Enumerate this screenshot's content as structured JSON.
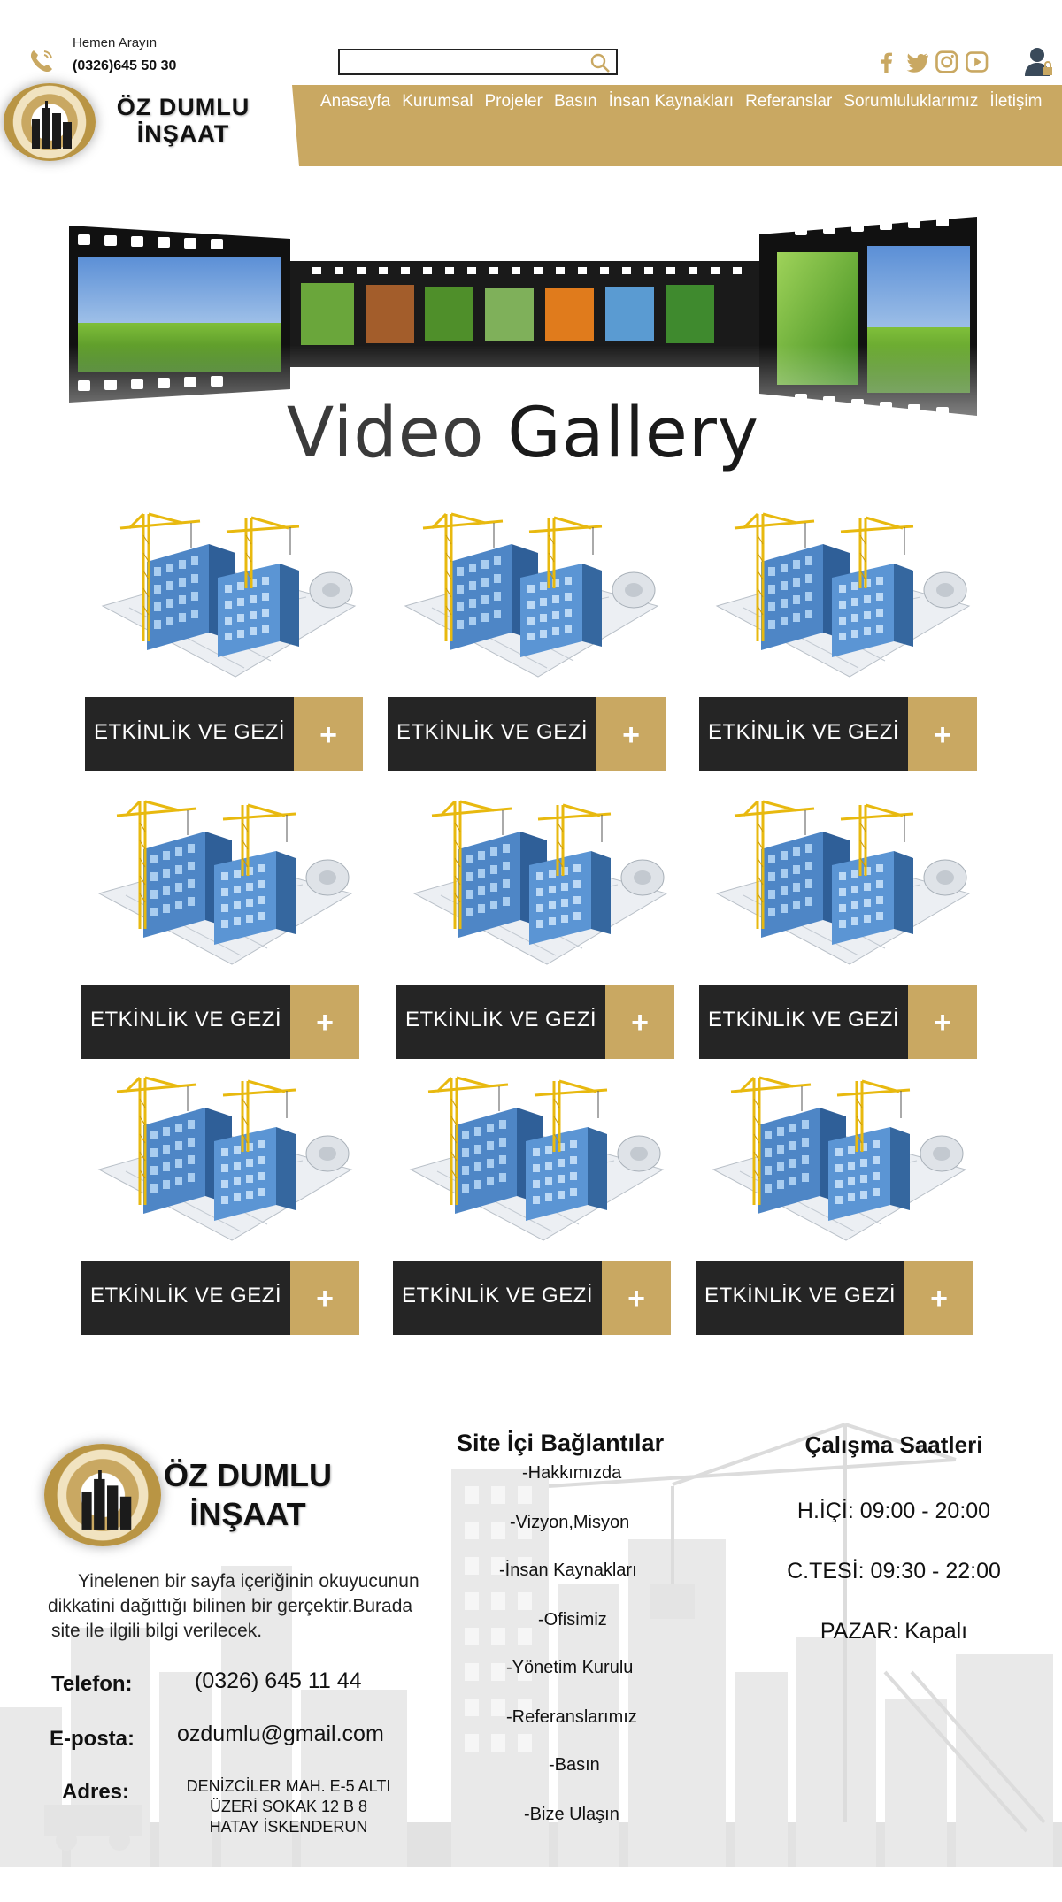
{
  "header": {
    "call_label": "Hemen Arayın",
    "call_number": "(0326)645 50 30",
    "logo_line1": "ÖZ DUMLU",
    "logo_line2": "İNŞAAT",
    "search_placeholder": "",
    "social_icons": [
      "facebook-icon",
      "twitter-icon",
      "instagram-icon",
      "youtube-icon"
    ],
    "nav": [
      "Anasayfa",
      "Kurumsal",
      "Projeler",
      "Basın",
      "İnsan Kaynakları",
      "Referanslar",
      "Sorumluluklarımız",
      "İletişim"
    ]
  },
  "hero": {
    "title_part1": "Video",
    "title_part2": "Gallery"
  },
  "gallery": {
    "items": [
      {
        "label": "ETKİNLİK VE GEZİ",
        "plus": "+"
      },
      {
        "label": "ETKİNLİK VE GEZİ",
        "plus": "+"
      },
      {
        "label": "ETKİNLİK VE GEZİ",
        "plus": "+"
      },
      {
        "label": "ETKİNLİK VE GEZİ",
        "plus": "+"
      },
      {
        "label": "ETKİNLİK VE GEZİ",
        "plus": "+"
      },
      {
        "label": "ETKİNLİK VE GEZİ",
        "plus": "+"
      },
      {
        "label": "ETKİNLİK VE GEZİ",
        "plus": "+"
      },
      {
        "label": "ETKİNLİK VE GEZİ",
        "plus": "+"
      },
      {
        "label": "ETKİNLİK VE GEZİ",
        "plus": "+"
      }
    ]
  },
  "footer": {
    "logo_line1": "ÖZ DUMLU",
    "logo_line2": "İNŞAAT",
    "desc_line1": "Yinelenen bir sayfa içeriğinin okuyucunun",
    "desc_line2": "dikkatini dağıttığı bilinen bir gerçektir.Burada",
    "desc_line3": "site ile ilgili  bilgi verilecek.",
    "phone_label": "Telefon:",
    "phone_value": "(0326) 645 11 44",
    "email_label": "E-posta:",
    "email_value": "ozdumlu@gmail.com",
    "address_label": "Adres:",
    "address_line1": "DENİZCİLER MAH. E-5 ALTI",
    "address_line2": "ÜZERİ SOKAK 12 B 8",
    "address_line3": "HATAY İSKENDERUN",
    "links_title": "Site İçi Bağlantılar",
    "links": [
      "-Hakkımızda",
      "-Vizyon,Misyon",
      "-İnsan Kaynakları",
      "-Ofisimiz",
      "-Yönetim Kurulu",
      "-Referanslarımız",
      "-Basın",
      "-Bize Ulaşın"
    ],
    "hours_title": "Çalışma Saatleri",
    "hours": [
      "H.İÇİ: 09:00 - 20:00",
      "C.TESİ: 09:30 - 22:00",
      "PAZAR: Kapalı"
    ]
  },
  "colors": {
    "accent": "#c9a862",
    "dark": "#252525"
  }
}
